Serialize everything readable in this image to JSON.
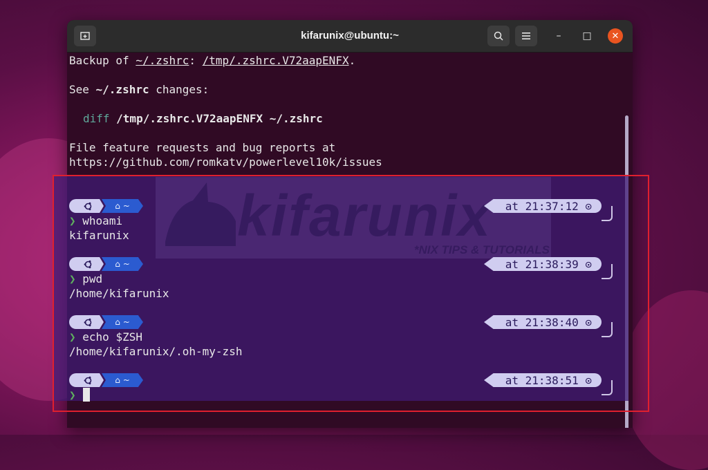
{
  "window": {
    "title": "kifarunix@ubuntu:~",
    "close_label": "✕",
    "minimize_label": "–",
    "maximize_label": "□"
  },
  "terminal": {
    "backup_prefix": "Backup of ",
    "backup_src": "~/.zshrc",
    "backup_colon": ": ",
    "backup_dst": "/tmp/.zshrc.V72aapENFX",
    "backup_dot": ".",
    "see_prefix": "See ",
    "see_file": "~/.zshrc",
    "see_suffix": " changes:",
    "diff_cmd": "diff",
    "diff_args": " /tmp/.zshrc.V72aapENFX ~/.zshrc",
    "report_line1": "File feature requests and bug reports at",
    "report_line2": "https://github.com/romkatv/powerlevel10k/issues"
  },
  "prompts": [
    {
      "dir": "~",
      "time": "at 21:37:12",
      "command": "whoami",
      "output": "kifarunix"
    },
    {
      "dir": "~",
      "time": "at 21:38:39",
      "command": "pwd",
      "output": "/home/kifarunix"
    },
    {
      "dir": "~",
      "time": "at 21:38:40",
      "command": "echo $ZSH",
      "output": "/home/kifarunix/.oh-my-zsh"
    },
    {
      "dir": "~",
      "time": "at 21:38:51",
      "command": "",
      "output": ""
    }
  ],
  "prompt_arrow": "❯",
  "watermark": {
    "brand": "kifarunix",
    "tagline": "*NIX TIPS & TUTORIALS"
  },
  "colors": {
    "terminal_bg": "#300a24",
    "highlight_border": "#e0202e",
    "os_segment": "#d0cdf0",
    "dir_segment": "#2b5bd0",
    "close_button": "#e95420"
  },
  "icons": {
    "new_tab": "new-tab-icon",
    "search": "search-icon",
    "menu": "hamburger-menu-icon",
    "os": "ubuntu-logo-icon",
    "home": "home-icon",
    "clock": "clock-icon"
  }
}
